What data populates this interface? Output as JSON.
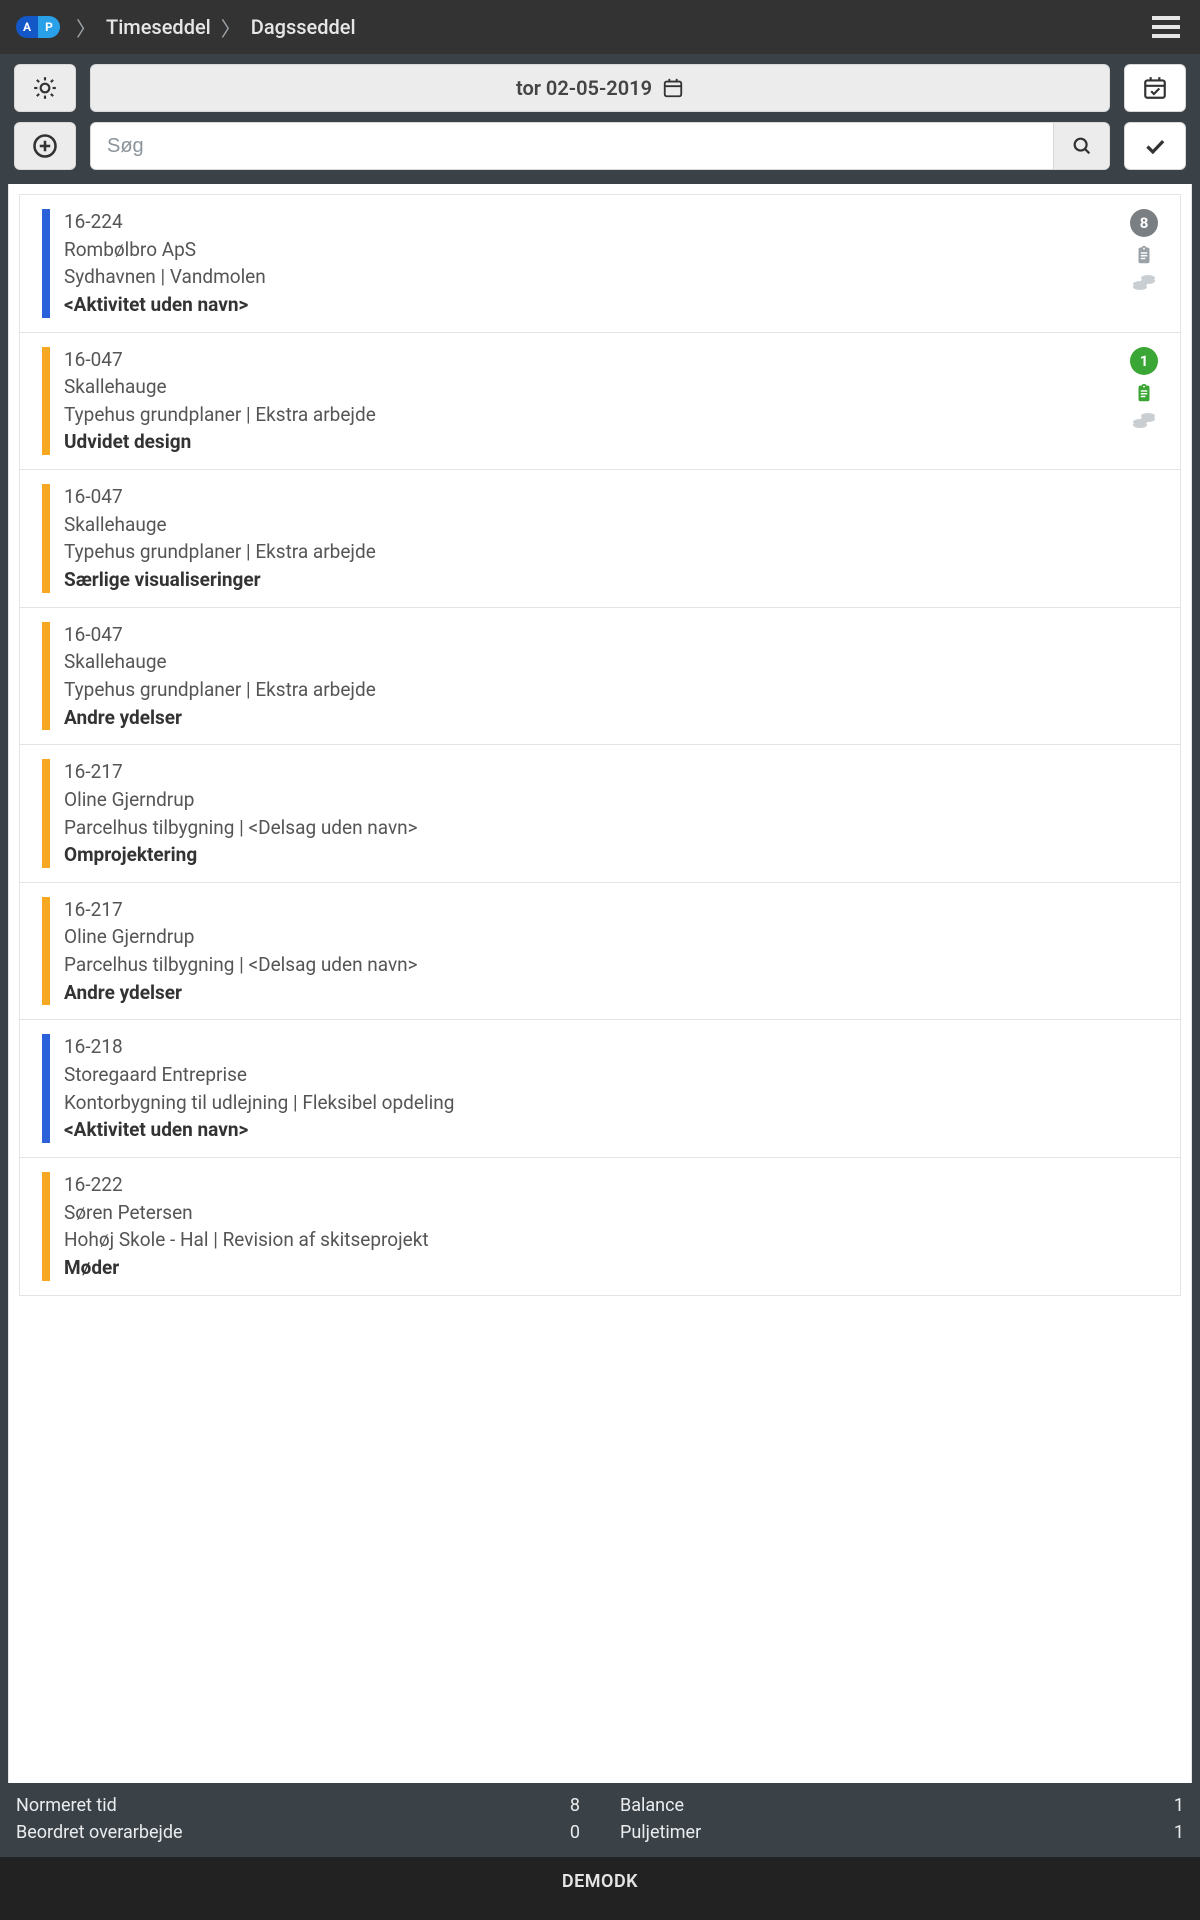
{
  "brand": {
    "initials_a": "A",
    "initials_p": "P",
    "footer_label": "DEMODK"
  },
  "breadcrumb": {
    "item1": "Timeseddel",
    "item2": "Dagsseddel"
  },
  "date_display": "tor 02-05-2019",
  "search": {
    "placeholder": "Søg"
  },
  "colors": {
    "blue": "#2b62d9",
    "orange": "#f7a823",
    "badge_gray": "#7a7f84",
    "badge_green": "#3aa635"
  },
  "rows": [
    {
      "stripe": "blue",
      "code": "16-224",
      "client": "Rombølbro ApS",
      "project": "Sydhavnen | Vandmolen",
      "activity": "<Aktivitet uden navn>",
      "badges": {
        "count": "8",
        "count_color": "gray",
        "clipboard": "inactive",
        "coins": true
      }
    },
    {
      "stripe": "orange",
      "code": "16-047",
      "client": "Skallehauge",
      "project": "Typehus grundplaner | Ekstra arbejde",
      "activity": "Udvidet design",
      "badges": {
        "count": "1",
        "count_color": "green",
        "clipboard": "active",
        "coins": true
      }
    },
    {
      "stripe": "orange",
      "code": "16-047",
      "client": "Skallehauge",
      "project": "Typehus grundplaner | Ekstra arbejde",
      "activity": "Særlige visualiseringer",
      "badges": null
    },
    {
      "stripe": "orange",
      "code": "16-047",
      "client": "Skallehauge",
      "project": "Typehus grundplaner | Ekstra arbejde",
      "activity": "Andre ydelser",
      "badges": null
    },
    {
      "stripe": "orange",
      "code": "16-217",
      "client": "Oline Gjerndrup",
      "project": "Parcelhus tilbygning | <Delsag uden navn>",
      "activity": "Omprojektering",
      "badges": null
    },
    {
      "stripe": "orange",
      "code": "16-217",
      "client": "Oline Gjerndrup",
      "project": "Parcelhus tilbygning | <Delsag uden navn>",
      "activity": "Andre ydelser",
      "badges": null
    },
    {
      "stripe": "blue",
      "code": "16-218",
      "client": "Storegaard Entreprise",
      "project": "Kontorbygning til udlejning | Fleksibel opdeling",
      "activity": "<Aktivitet uden navn>",
      "badges": null
    },
    {
      "stripe": "orange",
      "code": "16-222",
      "client": "Søren Petersen",
      "project": "Hohøj Skole - Hal | Revision af skitseprojekt",
      "activity": "Møder",
      "badges": null
    }
  ],
  "summary": {
    "normeret_label": "Normeret tid",
    "normeret_value": "8",
    "beordret_label": "Beordret overarbejde",
    "beordret_value": "0",
    "balance_label": "Balance",
    "balance_value": "1",
    "pulje_label": "Puljetimer",
    "pulje_value": "1"
  }
}
